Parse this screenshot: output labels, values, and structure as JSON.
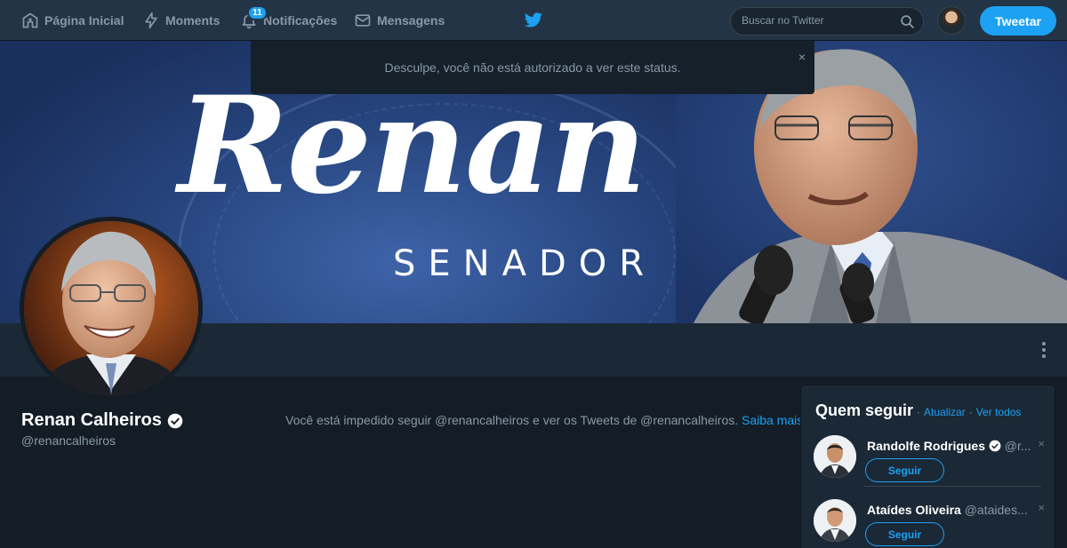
{
  "nav": {
    "home": "Página Inicial",
    "moments": "Moments",
    "notifications": "Notificações",
    "notifications_count": "11",
    "messages": "Mensagens",
    "search_placeholder": "Buscar no Twitter",
    "tweet_button": "Tweetar"
  },
  "alert": {
    "message": "Desculpe, você não está autorizado a ver este status.",
    "close": "×"
  },
  "banner": {
    "script_text": "Renan",
    "subtitle": "SENADOR"
  },
  "profile": {
    "name": "Renan Calheiros",
    "handle": "@renancalheiros",
    "blocked_message": "Você está impedido seguir @renancalheiros e ver os Tweets de @renancalheiros.",
    "learn_more": "Saiba mais"
  },
  "who_to_follow": {
    "title": "Quem seguir",
    "separator": "·",
    "refresh": "Atualizar",
    "view_all": "Ver todos",
    "suggestions": [
      {
        "name": "Randolfe Rodrigues",
        "handle": "@r...",
        "follow_label": "Seguir",
        "close": "×"
      },
      {
        "name": "Ataídes Oliveira",
        "handle": "@ataides...",
        "follow_label": "Seguir",
        "close": "×"
      }
    ]
  },
  "colors": {
    "background": "#141d26",
    "nav": "#243447",
    "accent": "#1da1f2",
    "muted_text": "#8899a6"
  }
}
